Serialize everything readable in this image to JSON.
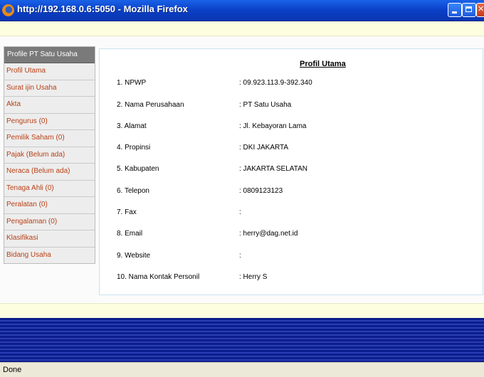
{
  "window": {
    "title": "http://192.168.0.6:5050 - Mozilla Firefox"
  },
  "sidebar": {
    "header": "Profile PT Satu Usaha",
    "items": [
      {
        "label": "Profil Utama"
      },
      {
        "label": "Surat ijin Usaha"
      },
      {
        "label": "Akta"
      },
      {
        "label": "Pengurus (0)"
      },
      {
        "label": "Pemilik Saham (0)"
      },
      {
        "label": "Pajak (Belum ada)"
      },
      {
        "label": "Neraca (Belum ada)"
      },
      {
        "label": "Tenaga Ahli (0)"
      },
      {
        "label": "Peralatan (0)"
      },
      {
        "label": "Pengalaman (0)"
      },
      {
        "label": "Klasifikasi"
      },
      {
        "label": "Bidang Usaha"
      }
    ]
  },
  "content": {
    "title": "Profil Utama",
    "rows": [
      {
        "label": "1. NPWP",
        "value": ": 09.923.113.9-392.340"
      },
      {
        "label": "2. Nama Perusahaan",
        "value": ": PT Satu Usaha"
      },
      {
        "label": "3. Alamat",
        "value": ": Jl. Kebayoran Lama"
      },
      {
        "label": "4. Propinsi",
        "value": ": DKI JAKARTA"
      },
      {
        "label": "5. Kabupaten",
        "value": ": JAKARTA SELATAN"
      },
      {
        "label": "6. Telepon",
        "value": ": 0809123123"
      },
      {
        "label": "7. Fax",
        "value": ":"
      },
      {
        "label": "8. Email",
        "value": ": herry@dag.net.id"
      },
      {
        "label": "9. Website",
        "value": ":"
      },
      {
        "label": "10. Nama Kontak Personil",
        "value": ": Herry S"
      }
    ]
  },
  "status": {
    "text": "Done"
  }
}
